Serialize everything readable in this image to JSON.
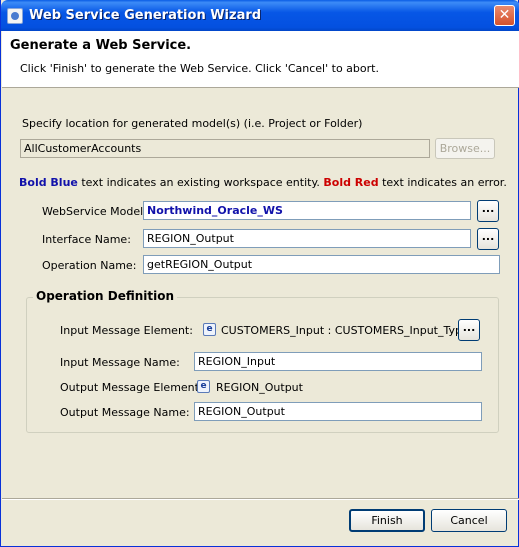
{
  "window": {
    "title": "Web Service Generation Wizard"
  },
  "header": {
    "title": "Generate a Web Service.",
    "subtitle": "Click 'Finish' to generate the Web Service.  Click 'Cancel' to abort."
  },
  "location": {
    "label": "Specify location for generated model(s) (i.e. Project or Folder)",
    "value": "AllCustomerAccounts",
    "browse_label": "Browse..."
  },
  "legend": {
    "bold_blue": "Bold Blue",
    "blue_desc": " text indicates an existing workspace entity.  ",
    "bold_red": "Bold Red",
    "red_desc": " text indicates an error."
  },
  "form": {
    "ws_model_label": "WebService Model:",
    "ws_model_value": "Northwind_Oracle_WS",
    "interface_label": "Interface Name:",
    "interface_value": "REGION_Output",
    "operation_label": "Operation Name:",
    "operation_value": "getREGION_Output",
    "ellipsis": "..."
  },
  "operation_definition": {
    "title": "Operation Definition",
    "input_element_label": "Input Message Element:",
    "input_element_icon": "e",
    "input_element_value": "CUSTOMERS_Input : CUSTOMERS_Input_Type",
    "input_name_label": "Input Message Name:",
    "input_name_value": "REGION_Input",
    "output_element_label": "Output Message Element:",
    "output_element_icon": "e",
    "output_element_value": "REGION_Output",
    "output_name_label": "Output Message Name:",
    "output_name_value": "REGION_Output"
  },
  "buttons": {
    "finish": "Finish",
    "cancel": "Cancel"
  },
  "colors": {
    "title_bar": "#0757e6",
    "bold_blue": "#1111aa",
    "bold_red": "#cc0000"
  }
}
